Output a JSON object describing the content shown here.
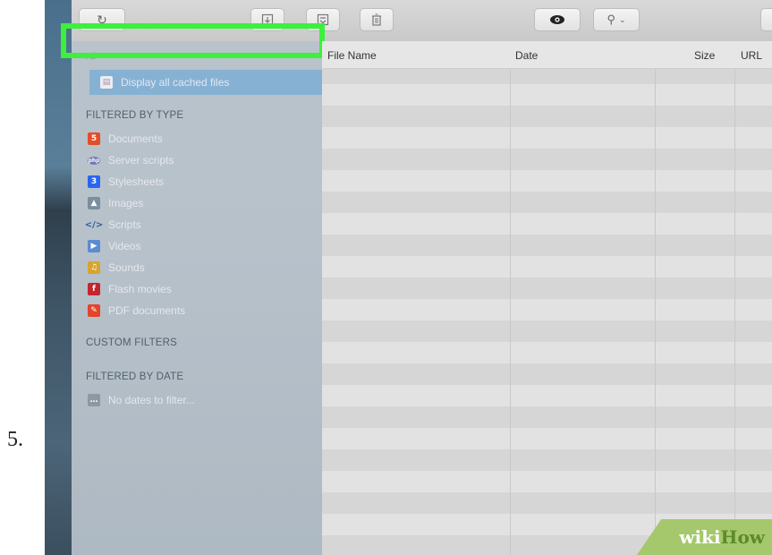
{
  "step": {
    "number": "5."
  },
  "toolbar": {
    "reload_icon": "reload-icon",
    "export_icon": "export-icon",
    "save_icon": "save-icon",
    "trash_icon": "trash-icon",
    "preview_icon": "eye-icon",
    "search_icon": "search-icon"
  },
  "sidebar": {
    "all_label": "All",
    "selected_item": "Display all cached files",
    "filtered_by_type_heading": "FILTERED BY TYPE",
    "type_items": [
      {
        "label": "Documents",
        "icon": "html5-icon",
        "color": "#e44d26"
      },
      {
        "label": "Server scripts",
        "icon": "php-icon",
        "color": "#6d7bb5"
      },
      {
        "label": "Stylesheets",
        "icon": "css3-icon",
        "color": "#2965f1"
      },
      {
        "label": "Images",
        "icon": "image-icon",
        "color": "#7a8fa0"
      },
      {
        "label": "Scripts",
        "icon": "code-icon",
        "color": "#2a5fa8"
      },
      {
        "label": "Videos",
        "icon": "video-icon",
        "color": "#5b8bd1"
      },
      {
        "label": "Sounds",
        "icon": "sound-icon",
        "color": "#d8a52c"
      },
      {
        "label": "Flash movies",
        "icon": "flash-icon",
        "color": "#c3262c"
      },
      {
        "label": "PDF documents",
        "icon": "pdf-icon",
        "color": "#e2452c"
      }
    ],
    "custom_filters_heading": "CUSTOM FILTERS",
    "filtered_by_date_heading": "FILTERED BY DATE",
    "date_empty": "No dates to filter..."
  },
  "table": {
    "columns": [
      "File Name",
      "Date",
      "Size",
      "URL"
    ]
  },
  "watermark": {
    "wiki": "wiki",
    "how": "How"
  },
  "colors": {
    "highlight": "#3cf03c",
    "selection": "#86b1d3"
  }
}
